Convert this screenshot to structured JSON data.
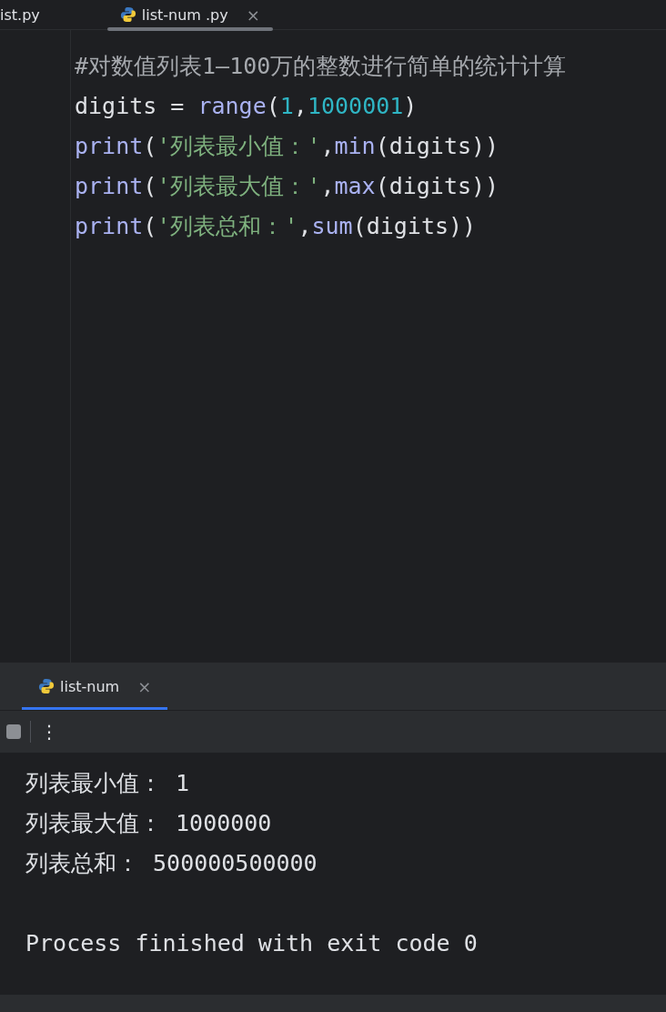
{
  "editor_tabs": [
    {
      "label": "ist.py",
      "selected": false,
      "python": false
    },
    {
      "label": "list-num .py",
      "selected": true,
      "python": true,
      "close": "×"
    }
  ],
  "code_lines": [
    [
      {
        "kind": "comment",
        "text": "#对数值列表1—100万的整数进行简单的统计计算"
      }
    ],
    [
      {
        "kind": "plain",
        "text": "digits = "
      },
      {
        "kind": "func",
        "text": "range"
      },
      {
        "kind": "plain",
        "text": "("
      },
      {
        "kind": "number",
        "text": "1"
      },
      {
        "kind": "plain",
        "text": ","
      },
      {
        "kind": "number",
        "text": "1000001"
      },
      {
        "kind": "plain",
        "text": ")"
      }
    ],
    [
      {
        "kind": "func",
        "text": "print"
      },
      {
        "kind": "plain",
        "text": "("
      },
      {
        "kind": "string",
        "text": "'列表最小值：'"
      },
      {
        "kind": "plain",
        "text": ","
      },
      {
        "kind": "func",
        "text": "min"
      },
      {
        "kind": "plain",
        "text": "(digits))"
      }
    ],
    [
      {
        "kind": "func",
        "text": "print"
      },
      {
        "kind": "plain",
        "text": "("
      },
      {
        "kind": "string",
        "text": "'列表最大值：'"
      },
      {
        "kind": "plain",
        "text": ","
      },
      {
        "kind": "func",
        "text": "max"
      },
      {
        "kind": "plain",
        "text": "(digits))"
      }
    ],
    [
      {
        "kind": "func",
        "text": "print"
      },
      {
        "kind": "plain",
        "text": "("
      },
      {
        "kind": "string",
        "text": "'列表总和：'"
      },
      {
        "kind": "plain",
        "text": ","
      },
      {
        "kind": "func",
        "text": "sum"
      },
      {
        "kind": "plain",
        "text": "(digits))"
      }
    ]
  ],
  "run_tabs": [
    {
      "label": "list-num",
      "selected": true,
      "close": "×"
    }
  ],
  "toolbar": {
    "more": "⋮"
  },
  "output_lines": [
    {
      "text": "列表最小值： 1",
      "gap_before": false
    },
    {
      "text": "列表最大值： 1000000",
      "gap_before": false
    },
    {
      "text": "列表总和： 500000500000",
      "gap_before": false
    },
    {
      "text": "Process finished with exit code 0",
      "gap_before": true
    }
  ]
}
